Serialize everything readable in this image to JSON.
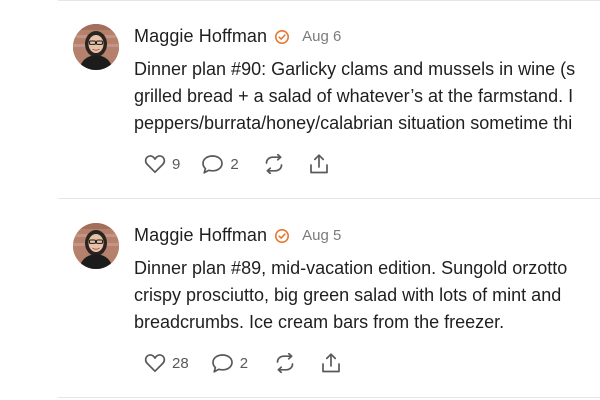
{
  "posts": [
    {
      "author": "Maggie Hoffman",
      "date": "Aug 6",
      "body_lines": [
        "Dinner plan #90: Garlicky clams and mussels in wine (s",
        "grilled bread + a salad of whatever’s at the farmstand. I",
        "peppers/burrata/honey/calabrian situation sometime thi"
      ],
      "likes": "9",
      "comments": "2"
    },
    {
      "author": "Maggie Hoffman",
      "date": "Aug 5",
      "body_lines": [
        "Dinner plan #89, mid-vacation edition. Sungold orzotto",
        "crispy prosciutto, big green salad with lots of mint and",
        "breadcrumbs. Ice cream bars from the freezer."
      ],
      "likes": "28",
      "comments": "2"
    }
  ],
  "icons": {
    "verified": "verified-badge-icon",
    "like": "heart-icon",
    "comment": "comment-bubble-icon",
    "restack": "restack-arrows-icon",
    "share": "share-upload-icon"
  },
  "colors": {
    "badge": "#e8772e",
    "text": "#1f1f1f",
    "muted": "#7b7b7b",
    "icon": "#595959",
    "divider": "#e6e6e6"
  }
}
